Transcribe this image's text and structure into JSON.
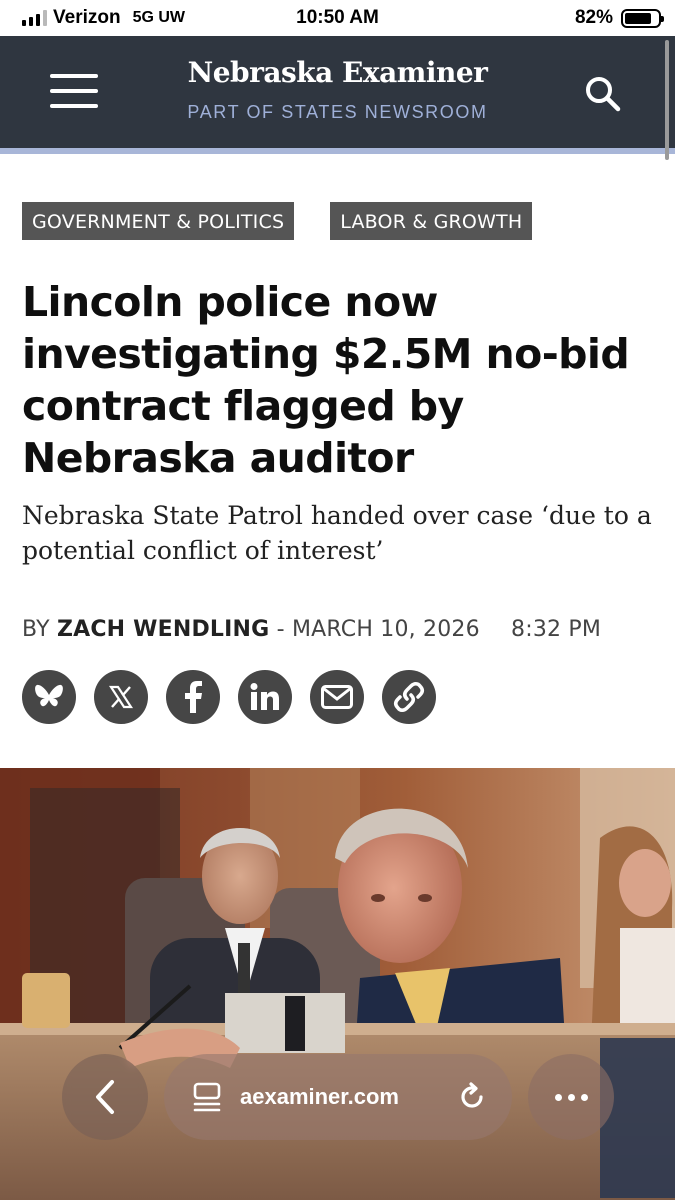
{
  "status_bar": {
    "carrier": "Verizon",
    "network": "5G UW",
    "time": "10:50 AM",
    "battery_percent": "82%",
    "battery_level": 0.82,
    "signal_bars_active": 3,
    "signal_bars_total": 4
  },
  "header": {
    "logo": "Nebraska Examiner",
    "tagline": "PART OF STATES NEWSROOM",
    "menu_icon": "hamburger-menu-icon",
    "search_icon": "search-icon",
    "bg_color": "#2f3640",
    "accent_color": "#a8b6d8"
  },
  "article": {
    "tags": [
      "GOVERNMENT & POLITICS",
      "LABOR & GROWTH"
    ],
    "headline": "Lincoln police now investigating $2.5M no-bid contract flagged by Nebraska auditor",
    "subhead": "Nebraska State Patrol handed over case ‘due to a potential conflict of interest’",
    "byline_prefix": "BY",
    "author": "ZACH WENDLING",
    "date": "MARCH 10, 2026",
    "time": "8:32 PM",
    "share_icons": [
      "bluesky-icon",
      "x-icon",
      "facebook-icon",
      "linkedin-icon",
      "email-icon",
      "link-icon"
    ]
  },
  "browser": {
    "url": "aexaminer.com",
    "back_icon": "chevron-left-icon",
    "reader_icon": "reader-mode-icon",
    "reload_icon": "reload-icon",
    "more_icon": "more-icon"
  }
}
